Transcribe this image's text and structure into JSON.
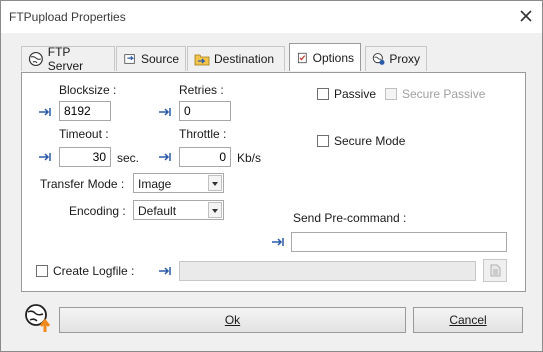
{
  "window": {
    "title": "FTPupload Properties"
  },
  "tabs": [
    {
      "label": "FTP Server",
      "icon": "globe-icon"
    },
    {
      "label": "Source",
      "icon": "source-icon"
    },
    {
      "label": "Destination",
      "icon": "folder-icon"
    },
    {
      "label": "Options",
      "icon": "options-icon",
      "active": true
    },
    {
      "label": "Proxy",
      "icon": "proxy-icon"
    }
  ],
  "options": {
    "blocksize_label": "Blocksize :",
    "blocksize_value": "8192",
    "retries_label": "Retries :",
    "retries_value": "0",
    "timeout_label": "Timeout :",
    "timeout_value": "30",
    "timeout_unit": "sec.",
    "throttle_label": "Throttle :",
    "throttle_value": "0",
    "throttle_unit": "Kb/s",
    "transfer_mode_label": "Transfer Mode :",
    "transfer_mode_value": "Image",
    "encoding_label": "Encoding :",
    "encoding_value": "Default",
    "passive_label": "Passive",
    "secure_passive_label": "Secure Passive",
    "secure_mode_label": "Secure Mode",
    "send_precommand_label": "Send Pre-command :",
    "send_precommand_value": "",
    "create_logfile_label": "Create Logfile :",
    "logfile_value": ""
  },
  "buttons": {
    "ok": "Ok",
    "cancel": "Cancel"
  },
  "colors": {
    "arrow": "#2a5aa8",
    "upload_arrow": "#f08a1c"
  }
}
